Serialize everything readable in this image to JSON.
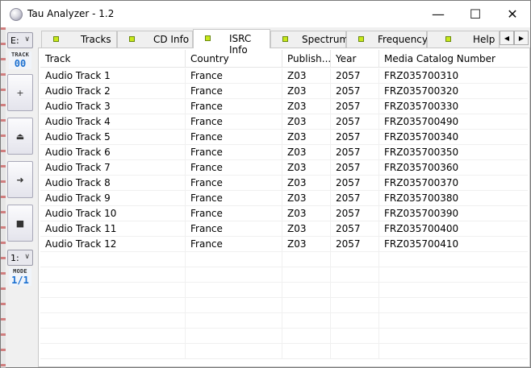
{
  "window": {
    "title": "Tau Analyzer - 1.2",
    "min_glyph": "—",
    "max_glyph": "☐",
    "close_glyph": "✕"
  },
  "left_panel": {
    "drive": "E:",
    "track_label": "TRACK",
    "track_value": "00",
    "mode_select": "1:",
    "mode_label": "MODE",
    "mode_value": "1/1",
    "buttons": [
      {
        "icon": "plus-icon",
        "glyph": "+"
      },
      {
        "icon": "eject-icon",
        "glyph": "⏏"
      },
      {
        "icon": "next-arrow-icon",
        "glyph": "➜"
      },
      {
        "icon": "stop-icon",
        "glyph": "■"
      }
    ]
  },
  "tabs": [
    {
      "label": "Tracks"
    },
    {
      "label": "CD Info"
    },
    {
      "label": "ISRC Info",
      "active": true
    },
    {
      "label": "Spectrum"
    },
    {
      "label": "Frequency"
    },
    {
      "label": "Help"
    }
  ],
  "grid": {
    "columns": [
      "Track",
      "Country",
      "Publish...",
      "Year",
      "Media Catalog Number"
    ],
    "rows": [
      [
        "Audio Track 1",
        "France",
        "Z03",
        "2057",
        "FRZ035700310"
      ],
      [
        "Audio Track 2",
        "France",
        "Z03",
        "2057",
        "FRZ035700320"
      ],
      [
        "Audio Track 3",
        "France",
        "Z03",
        "2057",
        "FRZ035700330"
      ],
      [
        "Audio Track 4",
        "France",
        "Z03",
        "2057",
        "FRZ035700490"
      ],
      [
        "Audio Track 5",
        "France",
        "Z03",
        "2057",
        "FRZ035700340"
      ],
      [
        "Audio Track 6",
        "France",
        "Z03",
        "2057",
        "FRZ035700350"
      ],
      [
        "Audio Track 7",
        "France",
        "Z03",
        "2057",
        "FRZ035700360"
      ],
      [
        "Audio Track 8",
        "France",
        "Z03",
        "2057",
        "FRZ035700370"
      ],
      [
        "Audio Track 9",
        "France",
        "Z03",
        "2057",
        "FRZ035700380"
      ],
      [
        "Audio Track 10",
        "France",
        "Z03",
        "2057",
        "FRZ035700390"
      ],
      [
        "Audio Track 11",
        "France",
        "Z03",
        "2057",
        "FRZ035700400"
      ],
      [
        "Audio Track 12",
        "France",
        "Z03",
        "2057",
        "FRZ035700410"
      ]
    ]
  }
}
